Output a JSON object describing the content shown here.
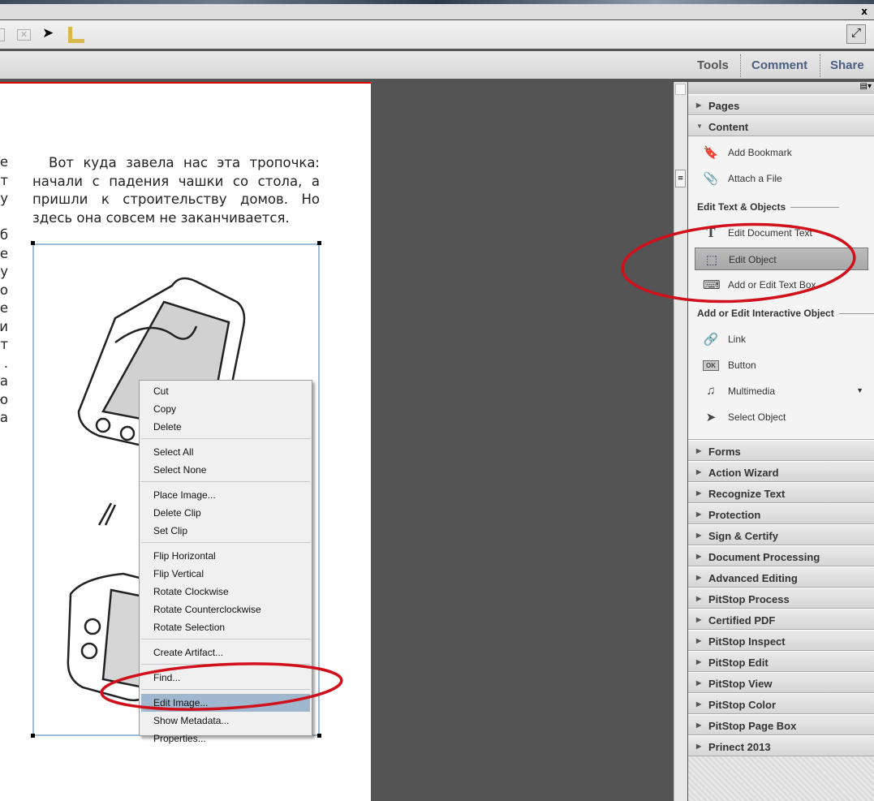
{
  "titlebar": {
    "close": "x"
  },
  "toolbar": {
    "icons": [
      "envelope-icon",
      "select-arrow-icon",
      "ruler-icon"
    ],
    "fullscreen": "expand-icon"
  },
  "tasks": {
    "tools": "Tools",
    "comment": "Comment",
    "share": "Share"
  },
  "document": {
    "paragraph": "Вот куда завела нас эта тропочка: начали с падения чашки со стола, а пришли к строительству домов. Но здесь она совсем не заканчивается.",
    "left_fragments": [
      "е-",
      "ит",
      "ху",
      "",
      "б-",
      "е",
      "у",
      "о",
      "е.",
      "и-",
      "от",
      ".",
      "а-",
      "ю",
      "а"
    ]
  },
  "context_menu": {
    "groups": [
      [
        "Cut",
        "Copy",
        "Delete"
      ],
      [
        "Select All",
        "Select None"
      ],
      [
        "Place Image...",
        "Delete Clip",
        "Set Clip"
      ],
      [
        "Flip Horizontal",
        "Flip Vertical",
        "Rotate Clockwise",
        "Rotate Counterclockwise",
        "Rotate Selection"
      ],
      [
        "Create Artifact..."
      ],
      [
        "Find..."
      ],
      [
        "Edit Image...",
        "Show Metadata...",
        "Properties..."
      ]
    ],
    "highlighted": "Edit Image..."
  },
  "panel": {
    "pages": "Pages",
    "content": "Content",
    "content_items": [
      "Add Bookmark",
      "Attach a File"
    ],
    "edit_heading": "Edit Text & Objects",
    "edit_items": [
      "Edit Document Text",
      "Edit Object",
      "Add or Edit Text Box"
    ],
    "interactive_heading": "Add or Edit Interactive Object",
    "interactive_items": [
      "Link",
      "Button",
      "Multimedia",
      "Select Object"
    ],
    "sections": [
      "Forms",
      "Action Wizard",
      "Recognize Text",
      "Protection",
      "Sign & Certify",
      "Document Processing",
      "Advanced Editing",
      "PitStop Process",
      "Certified PDF",
      "PitStop Inspect",
      "PitStop Edit",
      "PitStop View",
      "PitStop Color",
      "PitStop Page Box",
      "Prinect 2013"
    ]
  },
  "colors": {
    "annotation": "#d0101a",
    "highlight": "#9fb7cf"
  }
}
